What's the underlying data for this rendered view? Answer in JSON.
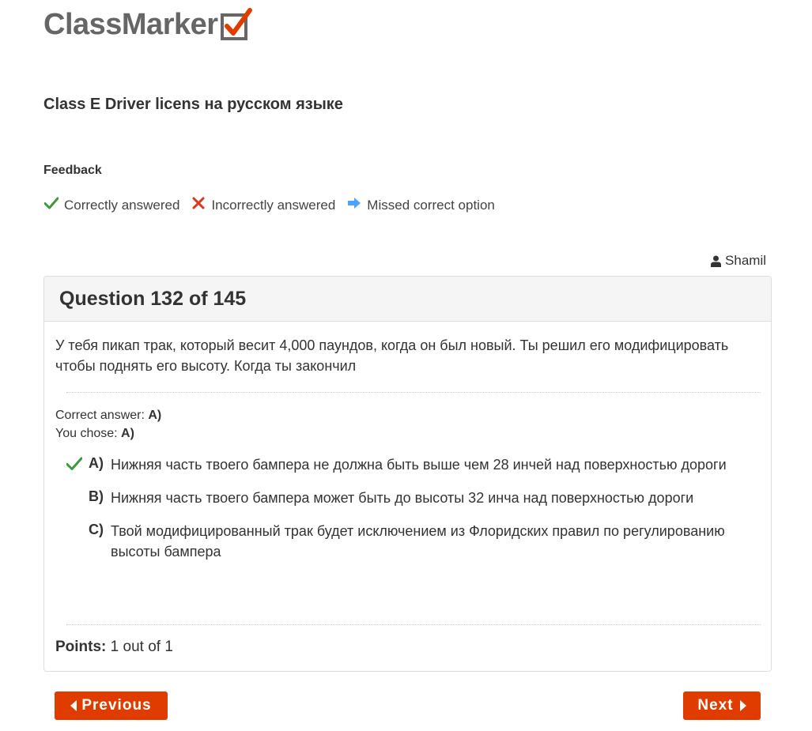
{
  "logo": {
    "text": "ClassMarker"
  },
  "quiz_title": "Class E Driver licens на русском языке",
  "feedback": {
    "heading": "Feedback",
    "legend": [
      {
        "icon": "check-icon",
        "color": "#3c9a3c",
        "label": "Correctly answered"
      },
      {
        "icon": "cross-icon",
        "color": "#d9381e",
        "label": "Incorrectly answered"
      },
      {
        "icon": "arrow-right-icon",
        "color": "#4da3ff",
        "label": "Missed correct option"
      }
    ]
  },
  "user": {
    "icon": "user-icon",
    "name": "Shamil"
  },
  "question": {
    "header": "Question 132 of 145",
    "text": "У тебя пикап трак, который весит 4,000 паундов, когда он был новый. Ты решил его модифицировать чтобы поднять его высоту. Когда ты закончил",
    "correct_answer_label": "Correct answer:",
    "correct_answer_value": "A)",
    "you_chose_label": "You chose:",
    "you_chose_value": "A)",
    "options": [
      {
        "letter": "A)",
        "text": "Нижняя часть твоего бампера не должна быть выше чем 28 инчей над поверхностью дороги",
        "mark": "check-icon"
      },
      {
        "letter": "B)",
        "text": "Нижняя часть твоего бампера может быть до высоты 32 инча над поверхностью дороги",
        "mark": ""
      },
      {
        "letter": "C)",
        "text": "Твой модифицированный трак будет исключением из Флоридских правил по регулированию высоты бампера",
        "mark": ""
      }
    ],
    "points_label": "Points:",
    "points_value": "1 out of 1"
  },
  "nav": {
    "previous_label": "Previous",
    "next_label": "Next",
    "button_color": "#e03c00"
  }
}
